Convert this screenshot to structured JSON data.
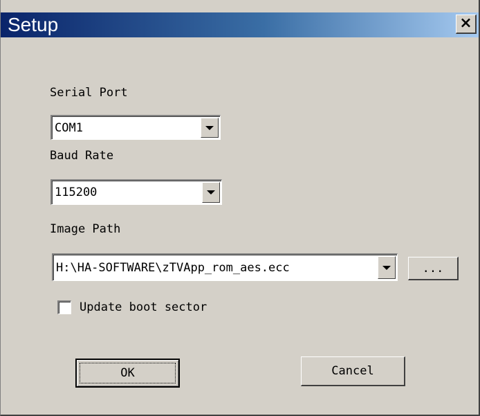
{
  "window": {
    "title": "Setup",
    "close_label": "×"
  },
  "serial_port": {
    "label": "Serial Port",
    "value": "COM1"
  },
  "baud_rate": {
    "label": "Baud Rate",
    "value": "115200"
  },
  "image_path": {
    "label": "Image Path",
    "value": "H:\\HA-SOFTWARE\\zTVApp_rom_aes.ecc",
    "browse_label": "..."
  },
  "update_boot": {
    "label": "Update boot sector",
    "checked": false
  },
  "buttons": {
    "ok_label": "OK",
    "cancel_label": "Cancel"
  },
  "colors": {
    "face": "#d4d0c8",
    "title_start": "#0a246a",
    "title_end": "#a6caf0"
  }
}
